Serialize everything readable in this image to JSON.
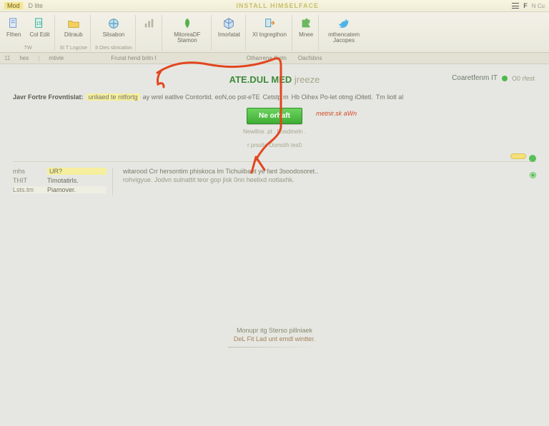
{
  "titlebar": {
    "tag1": "Mod",
    "tag2": "D lite",
    "center": "INSTALL  HIMSELFACE",
    "right1": "F",
    "right2": "N Cu"
  },
  "ribbon": {
    "items": [
      {
        "label": "Fthen",
        "icon": "doc-blue"
      },
      {
        "label": "Col Edit",
        "icon": "doc-teal"
      },
      {
        "label": "Ditraub",
        "icon": "folder"
      },
      {
        "label": "Slisabon",
        "icon": "globe"
      },
      {
        "label": "",
        "icon": "chart"
      },
      {
        "label": "MitoreaDF Stamon",
        "icon": "leaf"
      },
      {
        "label": "Imorlatat",
        "icon": "cube"
      },
      {
        "label": "XI tngregthon",
        "icon": "arrow"
      },
      {
        "label": "Mnee",
        "icon": "puzzle"
      },
      {
        "label": "mthencatem Jacopes",
        "icon": "bird"
      }
    ],
    "group_labels": [
      "",
      "TW",
      "SI T  Lngcise",
      "It  Dies sbrication",
      ""
    ]
  },
  "subrow": {
    "items": [
      "hes",
      "mtivle",
      "Frurat hend britn I",
      "Otharrene Ihetn",
      "Oacfsbns"
    ]
  },
  "heading": {
    "g": "ATE.DUL MED",
    "tail": "jreeze"
  },
  "status": {
    "text": "Coaretfenm IT",
    "sub": "O0 rfest"
  },
  "desc": {
    "lead": "Javr Fortre Frovntislat:",
    "hl": "unliaed te nitfortg",
    "mid1": "ay  wrel eatllve Contortid.  eoN,oo pst-eTE",
    "mid2": "Cetstp m",
    "mid3": "Hb Oihex Po-let otmg iOitetl.",
    "tail": "Tm liotl al"
  },
  "button": {
    "label": "Ne  orhaft"
  },
  "callout": "metnir.sk aWn",
  "subnote": "Newillos .pt . Rosdmeln .",
  "subnote2": "r prssite Domoth tes0",
  "panel": {
    "left": [
      {
        "k": "mhs",
        "v": "UR?",
        "hl": true
      },
      {
        "k": "THIT",
        "v": "Timotatirls."
      },
      {
        "k": "Lsts.tm",
        "v": "Piamover."
      }
    ],
    "right": [
      "witarood  Crr hersontim phiskoca lm  Tichuiibant ye  fant 3soodosoret..",
      "rohvigyue.   Jodvn sulnattit  teor gop jisk 0nn    heelixd notlaxhk."
    ]
  },
  "footer": {
    "l1": "Monupr itg Sterso pillniaek",
    "l2": "DeL  Fit Lad unt emdl wintter."
  }
}
